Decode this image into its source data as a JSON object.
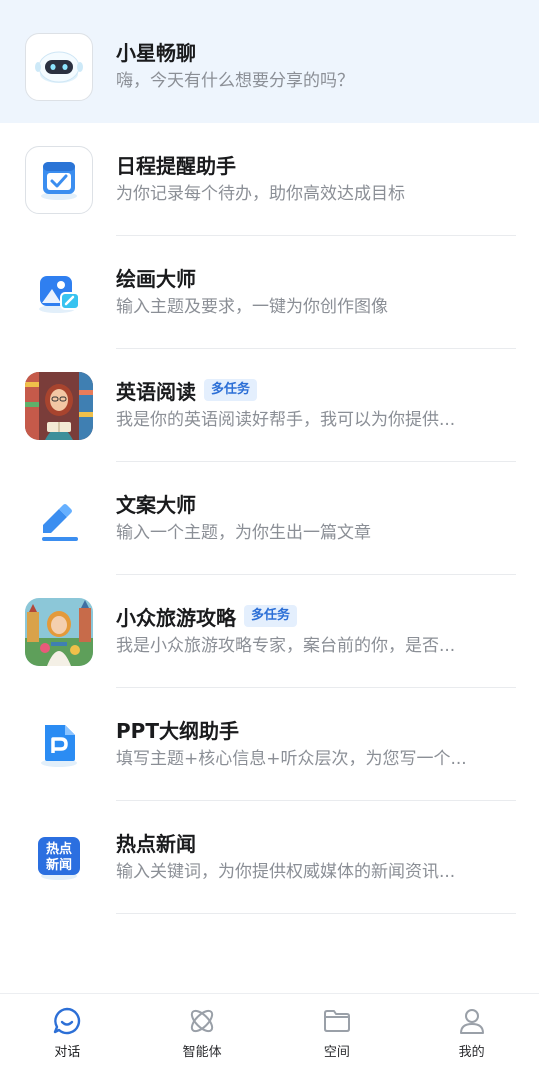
{
  "assistants": [
    {
      "title": "小星畅聊",
      "desc": "嗨，今天有什么想要分享的吗？",
      "badge": "",
      "icon": "robot-icon"
    },
    {
      "title": "日程提醒助手",
      "desc": "为你记录每个待办，助你高效达成目标",
      "badge": "",
      "icon": "calendar-check-icon"
    },
    {
      "title": "绘画大师",
      "desc": "输入主题及要求，一键为你创作图像",
      "badge": "",
      "icon": "image-edit-icon"
    },
    {
      "title": "英语阅读",
      "desc": "我是你的英语阅读好帮手，我可以为你提供...",
      "badge": "多任务",
      "icon": "reading-girl-avatar"
    },
    {
      "title": "文案大师",
      "desc": "输入一个主题，为你生出一篇文章",
      "badge": "",
      "icon": "pen-write-icon"
    },
    {
      "title": "小众旅游攻略",
      "desc": "我是小众旅游攻略专家，案台前的你，是否...",
      "badge": "多任务",
      "icon": "traveler-girl-avatar"
    },
    {
      "title": "PPT大纲助手",
      "desc": "填写主题+核心信息+听众层次，为您写一个...",
      "badge": "",
      "icon": "ppt-file-icon"
    },
    {
      "title": "热点新闻",
      "desc": "输入关键词，为你提供权威媒体的新闻资讯...",
      "badge": "",
      "icon": "hot-news-icon",
      "icon_text_top": "热点",
      "icon_text_bottom": "新闻"
    }
  ],
  "tabbar": {
    "tabs": [
      {
        "label": "对话",
        "icon": "chat-bubble-icon",
        "active": true
      },
      {
        "label": "智能体",
        "icon": "atom-icon",
        "active": false
      },
      {
        "label": "空间",
        "icon": "folder-icon",
        "active": false
      },
      {
        "label": "我的",
        "icon": "person-icon",
        "active": false
      }
    ]
  },
  "colors": {
    "accent": "#2c6fd6",
    "selected_row": "#eef5fd",
    "badge_bg": "#e4effd"
  }
}
